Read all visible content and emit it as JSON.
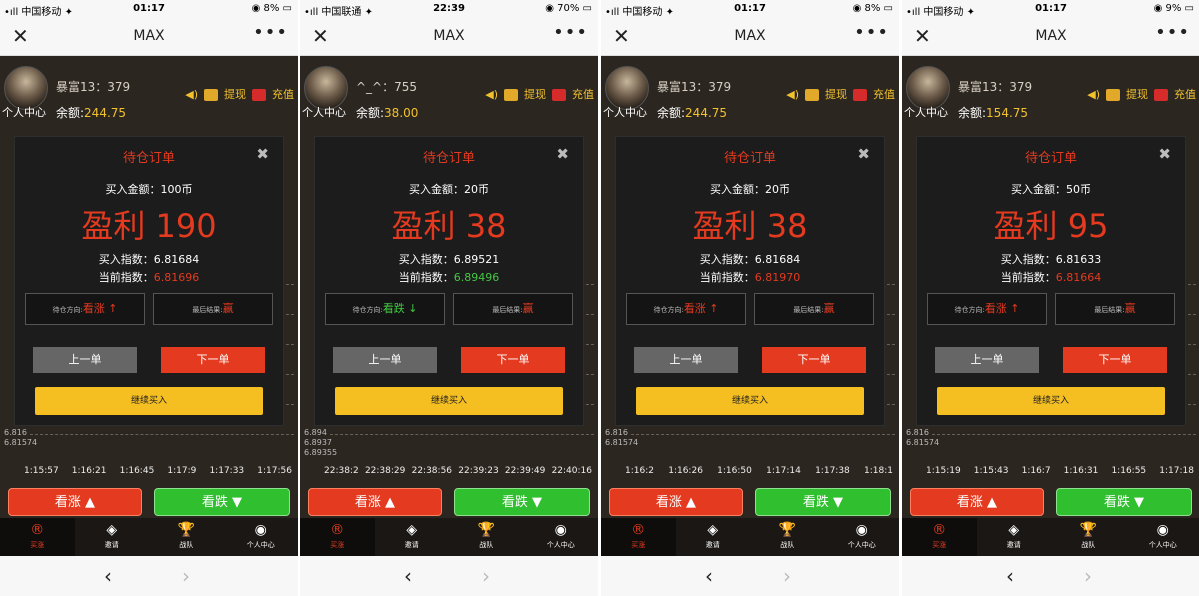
{
  "panels": [
    {
      "status": {
        "carrier": "•ıll 中国移动 ✦",
        "time": "01:17",
        "battery": "◉ 8% ▭"
      },
      "nav": {
        "title": "MAX"
      },
      "header": {
        "username": "暴富13：379",
        "balance_label": "余额:",
        "balance": "244.75",
        "avatar_label": "个人中心",
        "withdraw": "提现",
        "recharge": "充值"
      },
      "chart": {
        "y_labels": [
          "6.816",
          "6.81574"
        ],
        "x_labels": [
          "1:15:57",
          "1:16:21",
          "1:16:45",
          "1:17:9",
          "1:17:33",
          "1:17:56"
        ]
      },
      "modal": {
        "title": "待仓订单",
        "amount": "买入金额：100币",
        "profit": "盈利 190",
        "buy_index_label": "买入指数：",
        "buy_index": "6.81684",
        "current_index_label": "当前指数：",
        "current_index": "6.81696",
        "direction_label": "待仓方向:",
        "direction": "看涨 ↑",
        "result_label": "最后结果:",
        "result": "赢",
        "prev": "上一单",
        "next": "下一单",
        "continue": "继续买入"
      },
      "trade": {
        "up": "看涨 ▲",
        "down": "看跌 ▼"
      }
    },
    {
      "status": {
        "carrier": "•ıll 中国联通 ✦",
        "time": "22:39",
        "battery": "◉ 70% ▭"
      },
      "nav": {
        "title": "MAX"
      },
      "header": {
        "username": "^_^：755",
        "balance_label": "余额:",
        "balance": "38.00",
        "avatar_label": "个人中心",
        "withdraw": "提现",
        "recharge": "充值"
      },
      "chart": {
        "y_labels": [
          "6.894",
          "6.8937",
          "6.89355"
        ],
        "x_labels": [
          "22:38:2",
          "22:38:29",
          "22:38:56",
          "22:39:23",
          "22:39:49",
          "22:40:16"
        ]
      },
      "modal": {
        "title": "待仓订单",
        "amount": "买入金额：20币",
        "profit": "盈利 38",
        "buy_index_label": "买入指数：",
        "buy_index": "6.89521",
        "current_index_label": "当前指数：",
        "current_index": "6.89496",
        "direction_label": "待仓方向:",
        "direction": "看跌 ↓",
        "result_label": "最后结果:",
        "result": "赢",
        "prev": "上一单",
        "next": "下一单",
        "continue": "继续买入"
      },
      "trade": {
        "up": "看涨 ▲",
        "down": "看跌 ▼"
      }
    },
    {
      "status": {
        "carrier": "•ıll 中国移动 ✦",
        "time": "01:17",
        "battery": "◉ 8% ▭"
      },
      "nav": {
        "title": "MAX"
      },
      "header": {
        "username": "暴富13：379",
        "balance_label": "余额:",
        "balance": "244.75",
        "avatar_label": "个人中心",
        "withdraw": "提现",
        "recharge": "充值"
      },
      "chart": {
        "y_labels": [
          "6.816",
          "6.81574"
        ],
        "x_labels": [
          "1:16:2",
          "1:16:26",
          "1:16:50",
          "1:17:14",
          "1:17:38",
          "1:18:1"
        ]
      },
      "modal": {
        "title": "待仓订单",
        "amount": "买入金额：20币",
        "profit": "盈利 38",
        "buy_index_label": "买入指数：",
        "buy_index": "6.81684",
        "current_index_label": "当前指数：",
        "current_index": "6.81970",
        "direction_label": "待仓方向:",
        "direction": "看涨 ↑",
        "result_label": "最后结果:",
        "result": "赢",
        "prev": "上一单",
        "next": "下一单",
        "continue": "继续买入"
      },
      "trade": {
        "up": "看涨 ▲",
        "down": "看跌 ▼"
      }
    },
    {
      "status": {
        "carrier": "•ıll 中国移动 ✦",
        "time": "01:17",
        "battery": "◉ 9% ▭"
      },
      "nav": {
        "title": "MAX"
      },
      "header": {
        "username": "暴富13：379",
        "balance_label": "余额:",
        "balance": "154.75",
        "avatar_label": "个人中心",
        "withdraw": "提现",
        "recharge": "充值"
      },
      "chart": {
        "y_labels": [
          "6.816",
          "6.81574"
        ],
        "x_labels": [
          "1:15:19",
          "1:15:43",
          "1:16:7",
          "1:16:31",
          "1:16:55",
          "1:17:18"
        ]
      },
      "modal": {
        "title": "待仓订单",
        "amount": "买入金额：50币",
        "profit": "盈利 95",
        "buy_index_label": "买入指数：",
        "buy_index": "6.81633",
        "current_index_label": "当前指数：",
        "current_index": "6.81664",
        "direction_label": "待仓方向:",
        "direction": "看涨 ↑",
        "result_label": "最后结果:",
        "result": "赢",
        "prev": "上一单",
        "next": "下一单",
        "continue": "继续买入"
      },
      "trade": {
        "up": "看涨 ▲",
        "down": "看跌 ▼"
      }
    }
  ],
  "tabs": [
    "买涨",
    "邀请",
    "战队",
    "个人中心"
  ],
  "colors": {
    "up": "#e43a1f",
    "down": "#2fbf2f",
    "gold": "#f5be21",
    "bg": "#2b2620"
  }
}
